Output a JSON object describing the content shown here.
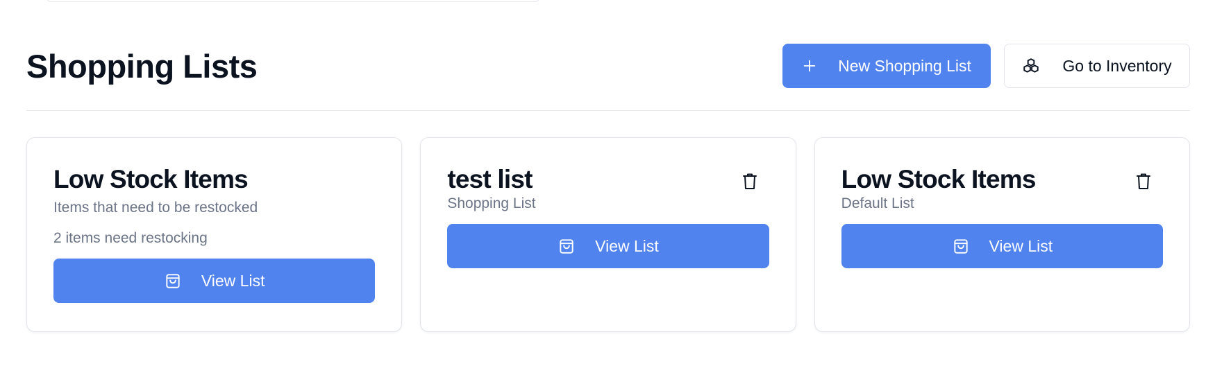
{
  "header": {
    "title": "Shopping Lists",
    "new_list_label": "New Shopping List",
    "inventory_label": "Go to Inventory"
  },
  "icons": {
    "new_list": "plus-icon",
    "inventory": "boxes-icon",
    "view_list": "shopping-bag-icon",
    "delete": "trash-icon"
  },
  "colors": {
    "primary": "#5183ee",
    "title": "#0b1220",
    "muted": "#6b7386",
    "border": "#e2e5eb"
  },
  "lists": [
    {
      "title": "Low Stock Items",
      "subtitle": "Items that need to be restocked",
      "count_text": "2 items need restocking",
      "view_label": "View List"
    },
    {
      "title": "test list",
      "subtitle": "Shopping List",
      "view_label": "View List"
    },
    {
      "title": "Low Stock Items",
      "subtitle": "Default List",
      "view_label": "View List"
    }
  ]
}
